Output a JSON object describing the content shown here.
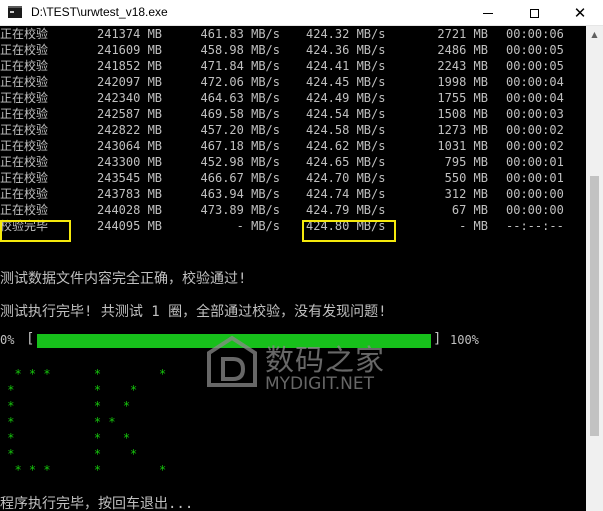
{
  "window": {
    "title": "D:\\TEST\\urwtest_v18.exe",
    "controls": [
      "minimize",
      "maximize",
      "close"
    ]
  },
  "log_rows": [
    {
      "status": "正在校验",
      "size": "241374 MB",
      "speed": "461.83 MB/s",
      "avg": "424.32 MB/s",
      "remaining": "2721 MB",
      "time": "00:00:06"
    },
    {
      "status": "正在校验",
      "size": "241609 MB",
      "speed": "458.98 MB/s",
      "avg": "424.36 MB/s",
      "remaining": "2486 MB",
      "time": "00:00:05"
    },
    {
      "status": "正在校验",
      "size": "241852 MB",
      "speed": "471.84 MB/s",
      "avg": "424.41 MB/s",
      "remaining": "2243 MB",
      "time": "00:00:05"
    },
    {
      "status": "正在校验",
      "size": "242097 MB",
      "speed": "472.06 MB/s",
      "avg": "424.45 MB/s",
      "remaining": "1998 MB",
      "time": "00:00:04"
    },
    {
      "status": "正在校验",
      "size": "242340 MB",
      "speed": "464.63 MB/s",
      "avg": "424.49 MB/s",
      "remaining": "1755 MB",
      "time": "00:00:04"
    },
    {
      "status": "正在校验",
      "size": "242587 MB",
      "speed": "469.58 MB/s",
      "avg": "424.54 MB/s",
      "remaining": "1508 MB",
      "time": "00:00:03"
    },
    {
      "status": "正在校验",
      "size": "242822 MB",
      "speed": "457.20 MB/s",
      "avg": "424.58 MB/s",
      "remaining": "1273 MB",
      "time": "00:00:02"
    },
    {
      "status": "正在校验",
      "size": "243064 MB",
      "speed": "467.18 MB/s",
      "avg": "424.62 MB/s",
      "remaining": "1031 MB",
      "time": "00:00:02"
    },
    {
      "status": "正在校验",
      "size": "243300 MB",
      "speed": "452.98 MB/s",
      "avg": "424.65 MB/s",
      "remaining": "795 MB",
      "time": "00:00:01"
    },
    {
      "status": "正在校验",
      "size": "243545 MB",
      "speed": "466.67 MB/s",
      "avg": "424.70 MB/s",
      "remaining": "550 MB",
      "time": "00:00:01"
    },
    {
      "status": "正在校验",
      "size": "243783 MB",
      "speed": "463.94 MB/s",
      "avg": "424.74 MB/s",
      "remaining": "312 MB",
      "time": "00:00:00"
    },
    {
      "status": "正在校验",
      "size": "244028 MB",
      "speed": "473.89 MB/s",
      "avg": "424.79 MB/s",
      "remaining": "67 MB",
      "time": "00:00:00"
    },
    {
      "status": "校验完毕",
      "size": "244095 MB",
      "speed": "- MB/s",
      "avg": "424.80 MB/s",
      "remaining": "- MB",
      "time": "--:--:--"
    }
  ],
  "messages": {
    "verify_ok": "测试数据文件内容完全正确，校验通过!",
    "summary": "测试执行完毕! 共测试 1 圈，全部通过校验，没有发现问题!",
    "exit_prompt": "程序执行完毕，按回车退出..."
  },
  "progress": {
    "start_label": "0%",
    "end_label": "100%",
    "bracket_open": "[",
    "bracket_close": "]",
    "fraction": 1.0,
    "bar_color": "#17c01b"
  },
  "ascii_art": [
    "  * * *      *        *",
    " *           *    *",
    " *           *   *",
    " *           * *",
    " *           *   *",
    " *           *    *",
    "  * * *      *        *"
  ],
  "watermark": {
    "brand_cn": "数码之家",
    "brand_en": "MYDIGIT.NET"
  },
  "colors": {
    "console_bg": "#000000",
    "console_text": "#c0c0c0",
    "ascii_art": "#16c60c",
    "highlight_box": "#f5e90c",
    "titlebar_bg": "#ffffff"
  }
}
